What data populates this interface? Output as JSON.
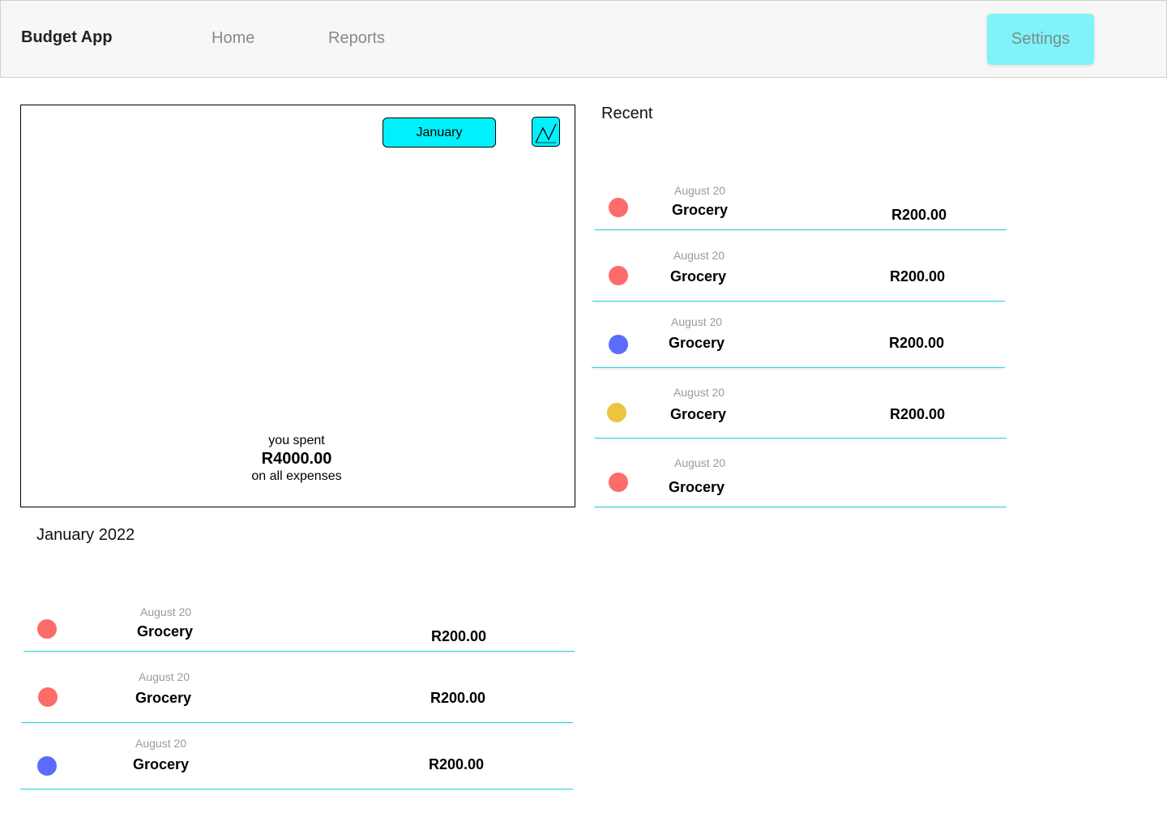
{
  "app": {
    "title": "Budget App"
  },
  "nav": {
    "home": "Home",
    "reports": "Reports",
    "settings": "Settings"
  },
  "colors": {
    "accent": "#00f1fd",
    "settings_bg": "#7ff3f7",
    "divider": "#22d7e6",
    "red": "#fd6b6b",
    "blue": "#5b6bfb",
    "yellow": "#ecc440"
  },
  "summary": {
    "month": "January",
    "chart_icon": "line-chart-icon",
    "spent_label": "you spent",
    "amount": "R4000.00",
    "caption": "on all expenses"
  },
  "recent": {
    "title": "Recent",
    "items": [
      {
        "date": "August 20",
        "name": "Grocery",
        "amount": "R200.00",
        "color": "red"
      },
      {
        "date": "August 20",
        "name": "Grocery",
        "amount": "R200.00",
        "color": "red"
      },
      {
        "date": "August 20",
        "name": "Grocery",
        "amount": "R200.00",
        "color": "blue"
      },
      {
        "date": "August 20",
        "name": "Grocery",
        "amount": "R200.00",
        "color": "yellow"
      },
      {
        "date": "August 20",
        "name": "Grocery",
        "amount": "",
        "color": "red"
      }
    ]
  },
  "month_list": {
    "title": "January 2022",
    "items": [
      {
        "date": "August 20",
        "name": "Grocery",
        "amount": "R200.00",
        "color": "red"
      },
      {
        "date": "August 20",
        "name": "Grocery",
        "amount": "R200.00",
        "color": "red"
      },
      {
        "date": "August 20",
        "name": "Grocery",
        "amount": "R200.00",
        "color": "blue"
      }
    ]
  }
}
